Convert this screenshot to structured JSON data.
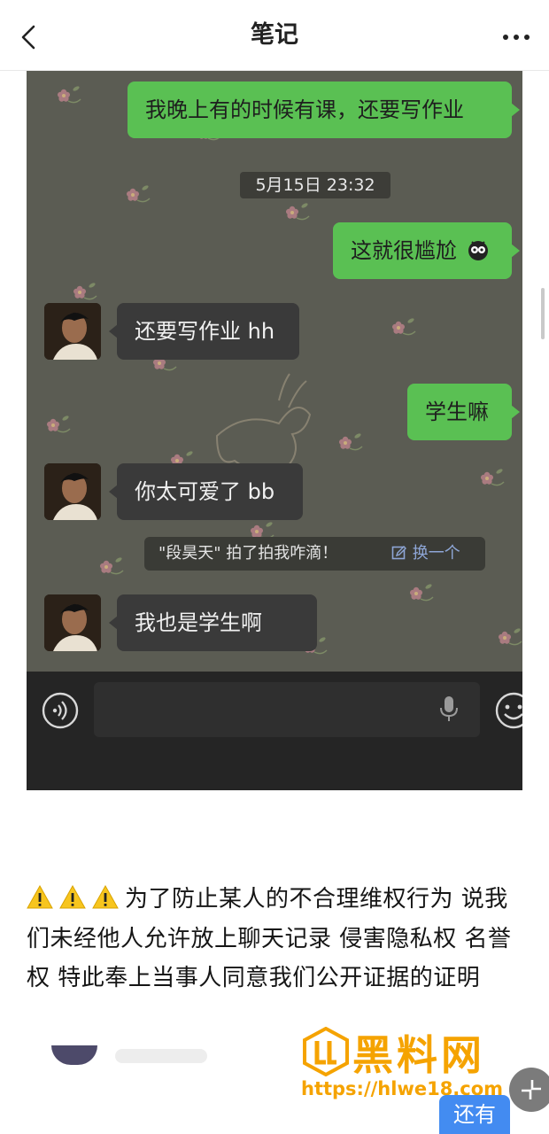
{
  "nav": {
    "title": "笔记",
    "back_icon": "chevron-left-icon",
    "more_icon": "more-horizontal-icon"
  },
  "chat": {
    "messages": [
      {
        "side": "out",
        "text": "我晚上有的时候有课，还要写作业"
      },
      {
        "side": "out",
        "text": "这就很尴尬"
      },
      {
        "side": "in",
        "text": "还要写作业 hh"
      },
      {
        "side": "out",
        "text": "学生嘛"
      },
      {
        "side": "in",
        "text": "你太可爱了 bb"
      },
      {
        "side": "in",
        "text": "我也是学生啊"
      }
    ],
    "timestamp": "5月15日 23:32",
    "pat_notice": {
      "text": "\"段昊天\" 拍了拍我咋滴！",
      "action": "换一个"
    },
    "colors": {
      "outgoing": "#5ac053",
      "incoming": "#3a3a3a"
    }
  },
  "caption": {
    "warning_icons": [
      "warning-icon",
      "warning-icon",
      "warning-icon"
    ],
    "text": "为了防止某人的不合理维权行为 说我们未经他人允许放上聊天记录 侵害隐私权 名誉权 特此奉上当事人同意我们公开证据的证明"
  },
  "watermark": {
    "title": "黑料网",
    "url": "https://hlwe18.com"
  },
  "footer": {
    "more_label": "还有"
  }
}
